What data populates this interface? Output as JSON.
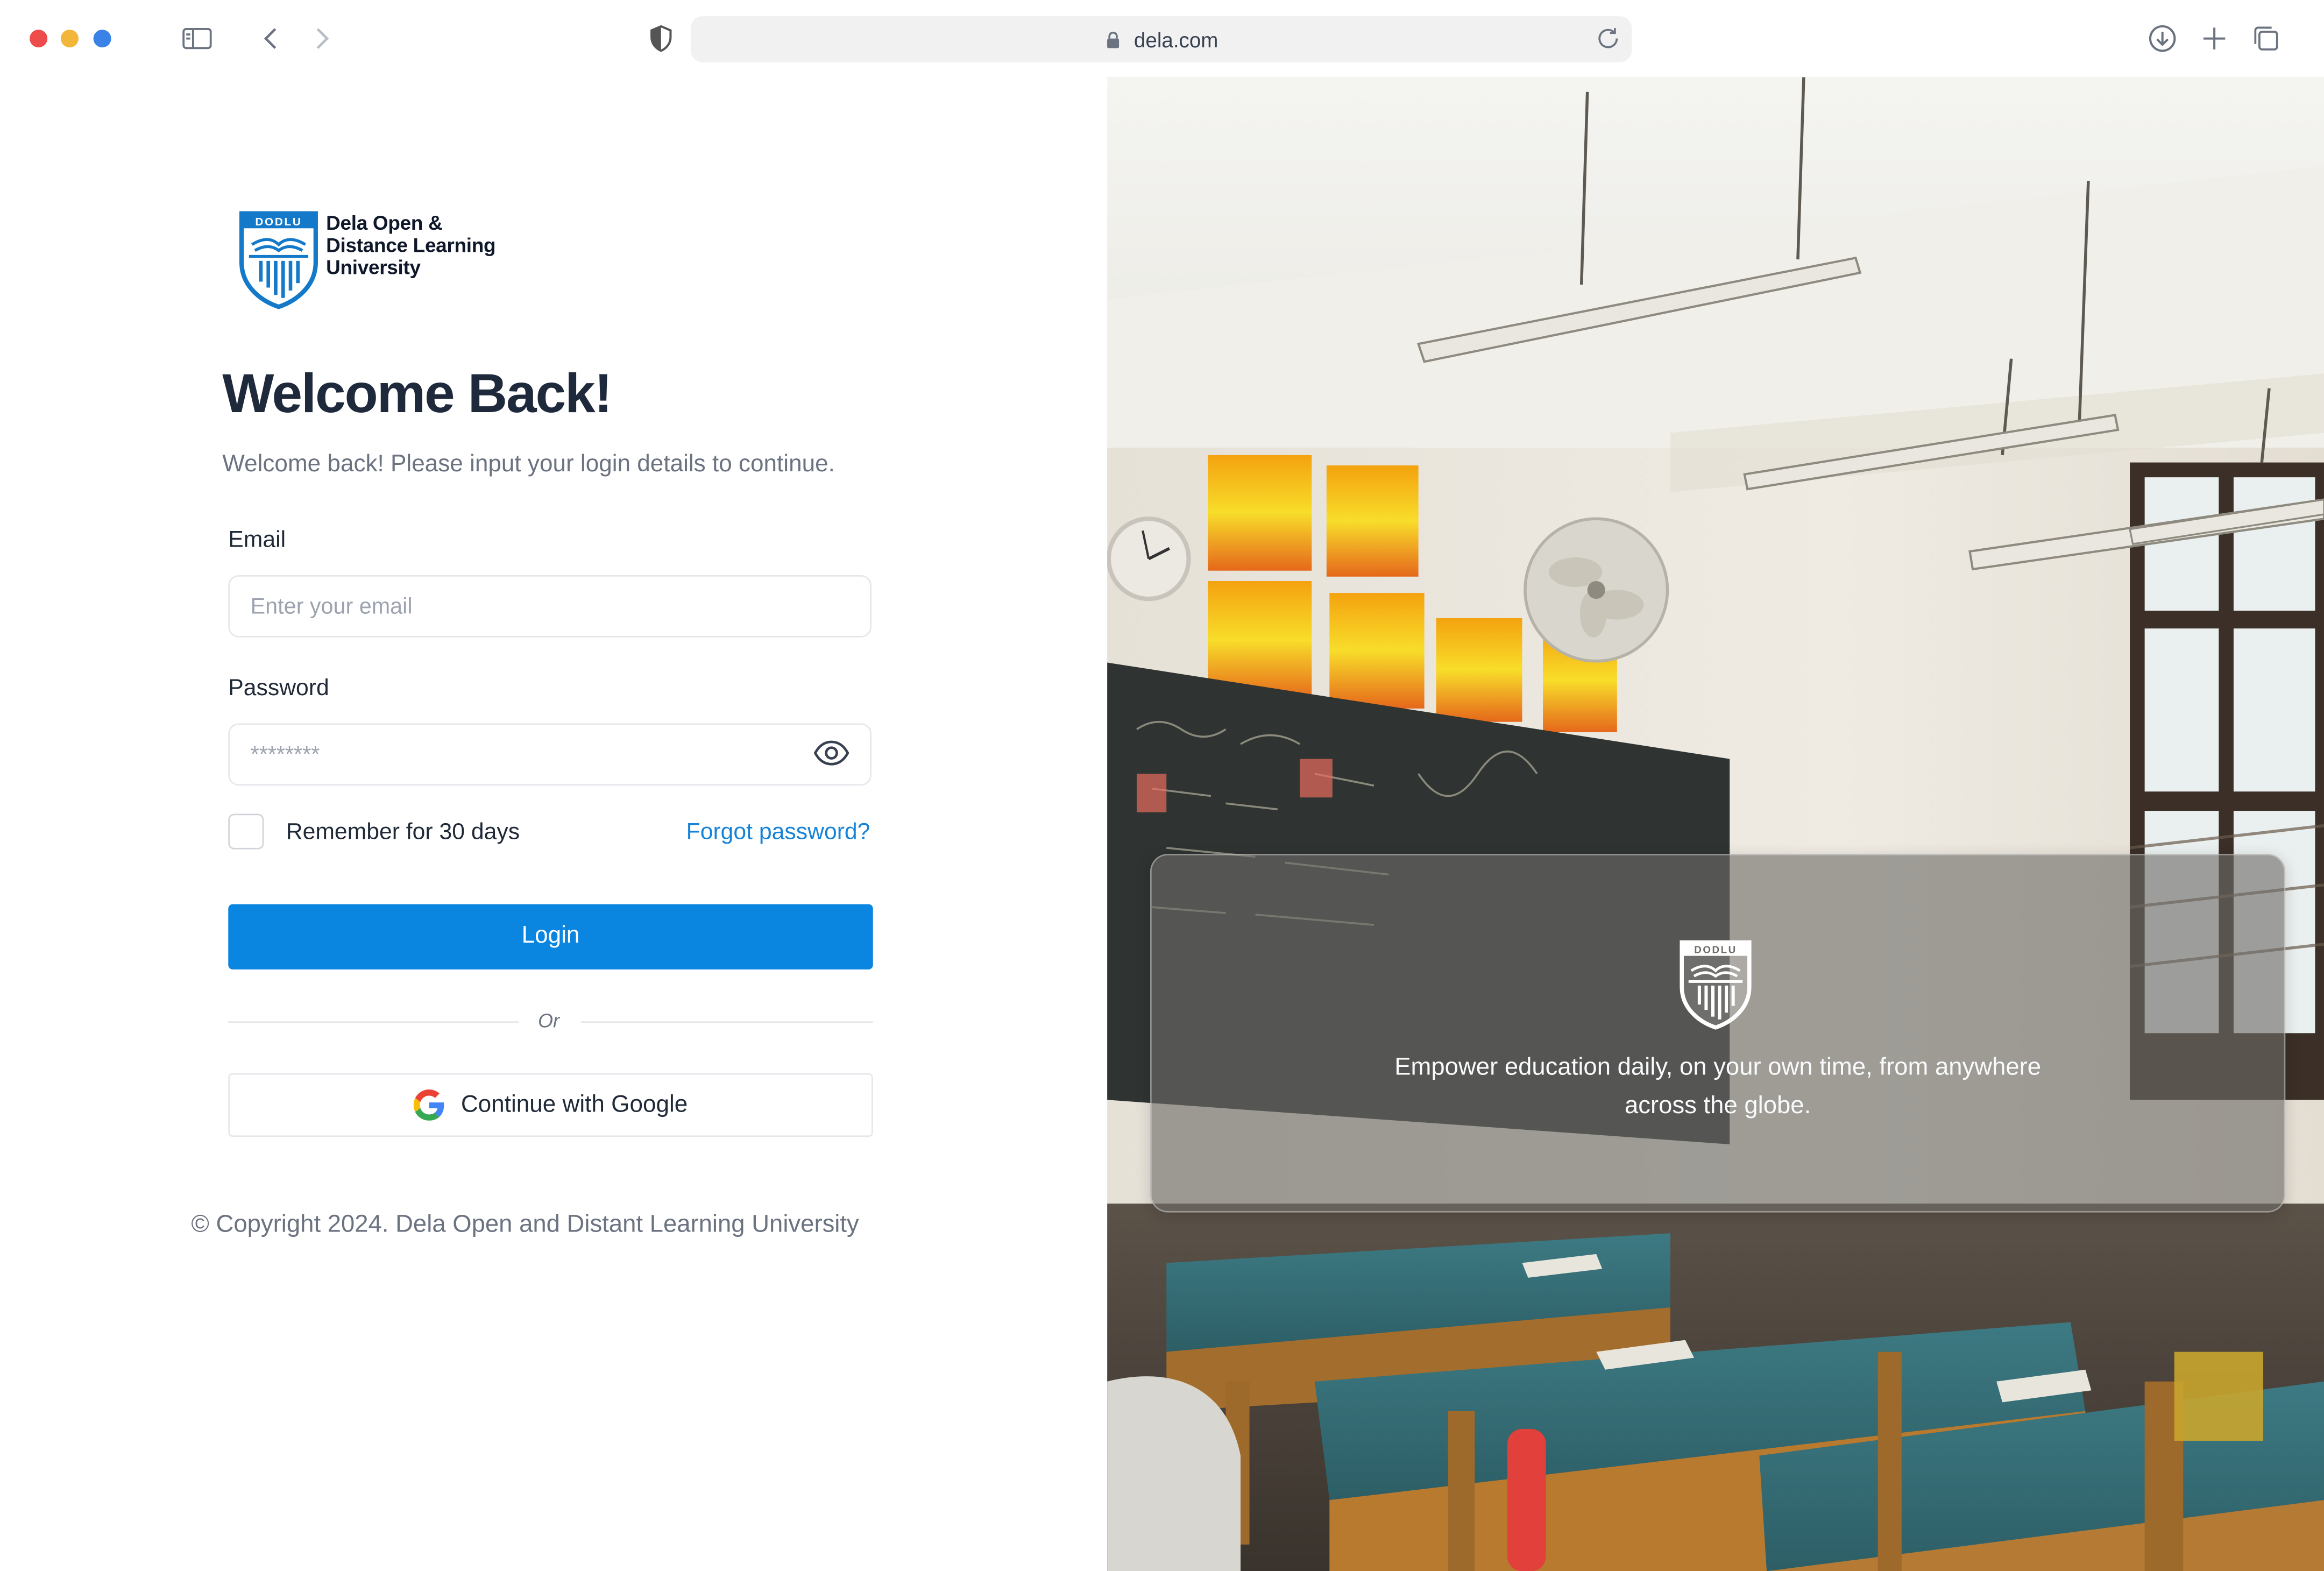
{
  "browser": {
    "url": "dela.com"
  },
  "brand": {
    "shield_text": "DODLU",
    "name_lines": [
      "Dela Open &",
      "Distance Learning",
      "University"
    ]
  },
  "login": {
    "title": "Welcome Back!",
    "subtitle": "Welcome back! Please input your login details to continue.",
    "email_label": "Email",
    "email_placeholder": "Enter your email",
    "password_label": "Password",
    "password_placeholder": "********",
    "remember_label": "Remember for 30 days",
    "forgot_link": "Forgot password?",
    "login_button": "Login",
    "divider_text": "Or",
    "google_button": "Continue with Google"
  },
  "footer": {
    "copyright": "© Copyright 2024. Dela Open and Distant Learning University"
  },
  "hero": {
    "tagline": "Empower education daily, on your own time, from anywhere across the globe."
  },
  "colors": {
    "primary": "#0a85e0",
    "link": "#1683d8",
    "heading": "#1e293b"
  }
}
